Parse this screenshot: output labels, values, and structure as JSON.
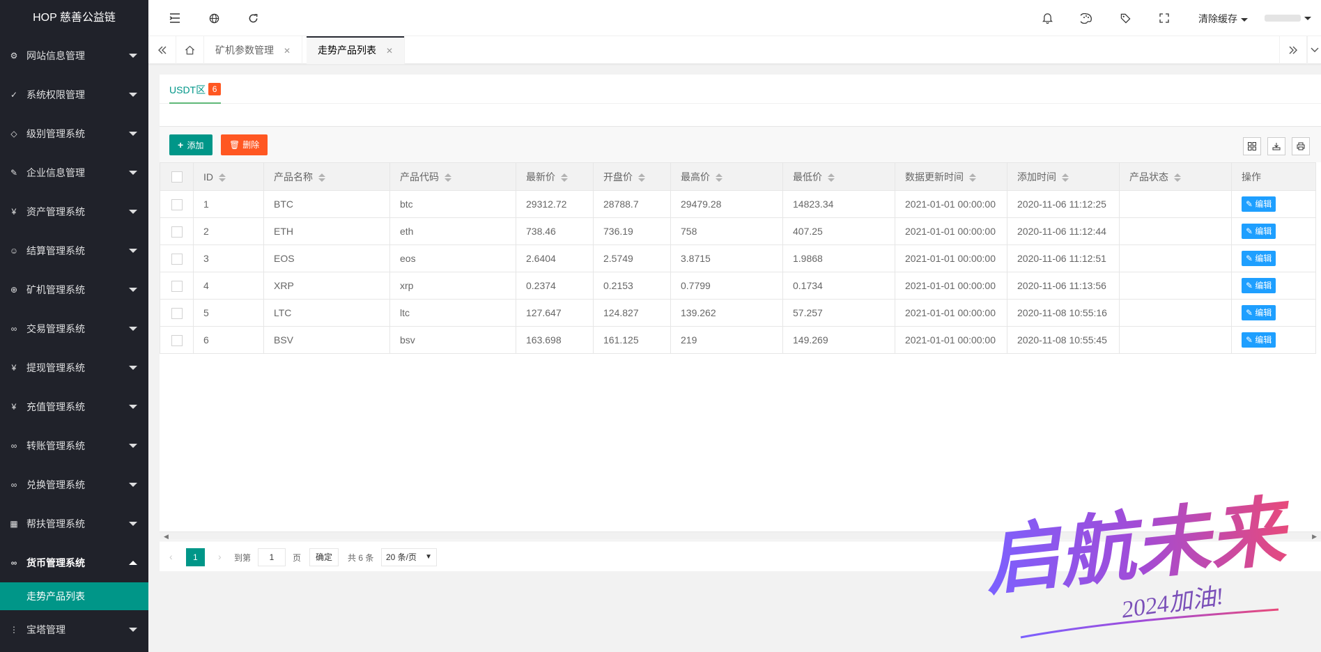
{
  "sidebar": {
    "logo": "HOP 慈善公益链",
    "items": [
      {
        "label": "网站信息管理",
        "icon": "⚙"
      },
      {
        "label": "系统权限管理",
        "icon": "✓"
      },
      {
        "label": "级别管理系统",
        "icon": "◇"
      },
      {
        "label": "企业信息管理",
        "icon": "✎"
      },
      {
        "label": "资产管理系统",
        "icon": "¥"
      },
      {
        "label": "结算管理系统",
        "icon": "☺"
      },
      {
        "label": "矿机管理系统",
        "icon": "⊕"
      },
      {
        "label": "交易管理系统",
        "icon": "∞"
      },
      {
        "label": "提现管理系统",
        "icon": "¥"
      },
      {
        "label": "充值管理系统",
        "icon": "¥"
      },
      {
        "label": "转账管理系统",
        "icon": "∞"
      },
      {
        "label": "兑换管理系统",
        "icon": "∞"
      },
      {
        "label": "帮扶管理系统",
        "icon": "▦"
      },
      {
        "label": "货币管理系统",
        "icon": "∞"
      },
      {
        "label": "宝塔管理",
        "icon": "⋮"
      }
    ],
    "submenu_item": "走势产品列表"
  },
  "header": {
    "clear_cache": "清除缓存"
  },
  "tabs": [
    {
      "label": "矿机参数管理"
    },
    {
      "label": "走势产品列表"
    }
  ],
  "content": {
    "tab_label": "USDT区",
    "tab_badge": "6",
    "add_label": "添加",
    "delete_label": "删除",
    "columns": [
      "ID",
      "产品名称",
      "产品代码",
      "最新价",
      "开盘价",
      "最高价",
      "最低价",
      "数据更新时间",
      "添加时间",
      "产品状态",
      "操作"
    ],
    "edit_label": "编辑",
    "rows": [
      [
        "1",
        "BTC",
        "btc",
        "29312.72",
        "28788.7",
        "29479.28",
        "14823.34",
        "2021-01-01 00:00:00",
        "2020-11-06 11:12:25"
      ],
      [
        "2",
        "ETH",
        "eth",
        "738.46",
        "736.19",
        "758",
        "407.25",
        "2021-01-01 00:00:00",
        "2020-11-06 11:12:44"
      ],
      [
        "3",
        "EOS",
        "eos",
        "2.6404",
        "2.5749",
        "3.8715",
        "1.9868",
        "2021-01-01 00:00:00",
        "2020-11-06 11:12:51"
      ],
      [
        "4",
        "XRP",
        "xrp",
        "0.2374",
        "0.2153",
        "0.7799",
        "0.1734",
        "2021-01-01 00:00:00",
        "2020-11-06 11:13:56"
      ],
      [
        "5",
        "LTC",
        "ltc",
        "127.647",
        "124.827",
        "139.262",
        "57.257",
        "2021-01-01 00:00:00",
        "2020-11-08 10:55:16"
      ],
      [
        "6",
        "BSV",
        "bsv",
        "163.698",
        "161.125",
        "219",
        "149.269",
        "2021-01-01 00:00:00",
        "2020-11-08 10:55:45"
      ]
    ]
  },
  "pager": {
    "current": "1",
    "goto_label": "到第",
    "page_value": "1",
    "page_unit": "页",
    "confirm": "确定",
    "total": "共 6 条",
    "per_page": "20 条/页"
  },
  "watermark": {
    "title": "启航未来",
    "subtitle": "2024加油!"
  }
}
